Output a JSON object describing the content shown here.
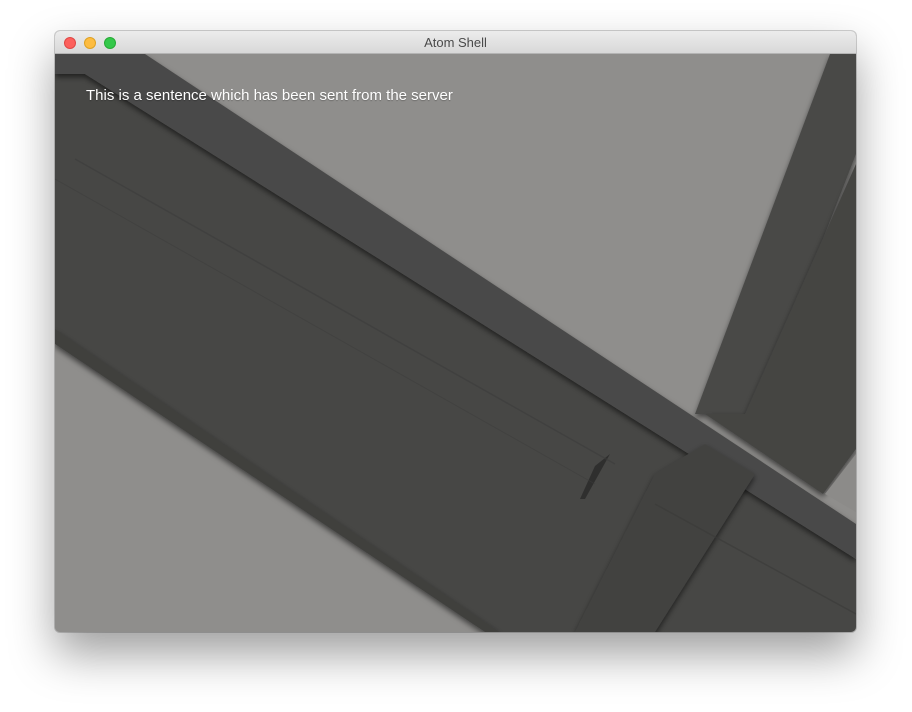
{
  "window": {
    "title": "Atom Shell",
    "controls": [
      "close",
      "minimize",
      "maximize"
    ]
  },
  "content": {
    "message": "This is a sentence which has been sent from the server"
  },
  "colors": {
    "wallpaper_light": "#8f8e8c",
    "wallpaper_dark": "#454544",
    "text": "#ffffff",
    "close": "#fc605c",
    "minimize": "#fdbc40",
    "maximize": "#34c84a"
  }
}
